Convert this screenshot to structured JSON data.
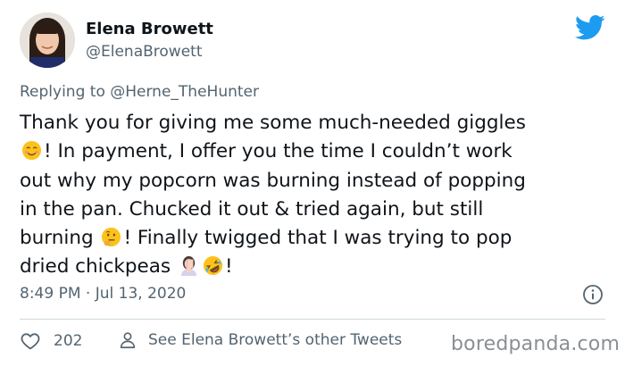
{
  "author": {
    "display_name": "Elena Browett",
    "handle": "@ElenaBrowett",
    "avatar_icon": "profile-photo"
  },
  "brand": {
    "icon": "twitter-bird-icon",
    "color": "#1d9bf0"
  },
  "reply": {
    "prefix": "Replying to ",
    "mention": "@Herne_TheHunter"
  },
  "tweet": {
    "lines": [
      {
        "text": "Thank you for giving me some much-needed giggles"
      },
      {
        "emoji": "smiling-face-with-heart-eyes",
        "text": "! In payment, I offer you the time I couldn’t work"
      },
      {
        "text": "out why my popcorn was burning instead of popping"
      },
      {
        "text": "in the pan. Chucked it out & tried again, but still"
      },
      {
        "text_before": "burning ",
        "emoji": "thinking-face",
        "text": "! Finally twigged that I was trying to pop"
      },
      {
        "text_before": "dried chickpeas ",
        "emoji": "woman-facepalming",
        "emoji2": "rolling-on-floor-laughing",
        "text": "!"
      }
    ],
    "timestamp": "8:49 PM · Jul 13, 2020"
  },
  "actions": {
    "like_count": "202",
    "like_icon": "heart-icon",
    "profile_icon": "person-icon",
    "other_tweets_label": "See Elena Browett’s other Tweets",
    "info_icon": "info-icon"
  },
  "watermark": "boredpanda.com"
}
